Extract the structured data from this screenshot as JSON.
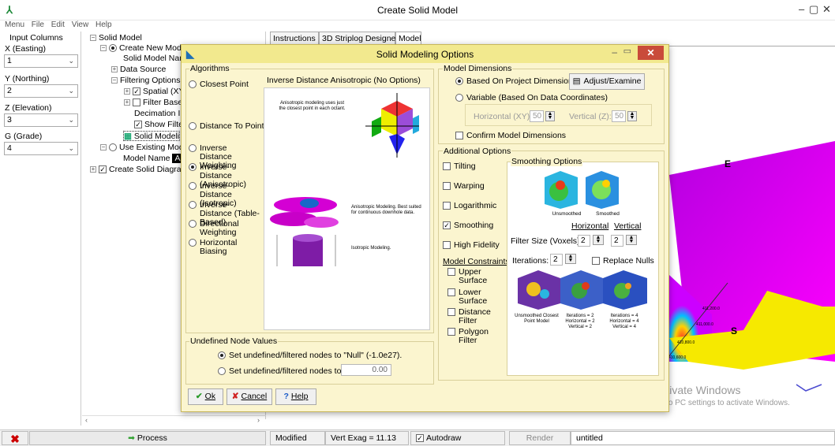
{
  "window": {
    "title": "Create Solid Model",
    "minimize": "–",
    "maximize": "▢",
    "close": "✕"
  },
  "menu": [
    "Menu",
    "File",
    "Edit",
    "View",
    "Help"
  ],
  "input_columns": {
    "header": "Input Columns",
    "fields": [
      {
        "label": "X (Easting)",
        "value": "1"
      },
      {
        "label": "Y (Northing)",
        "value": "2"
      },
      {
        "label": "Z (Elevation)",
        "value": "3"
      },
      {
        "label": "G (Grade)",
        "value": "4"
      }
    ]
  },
  "tree": {
    "root": "Solid Model",
    "create_new": "Create New Mode",
    "model_name_item": "Solid Model Nam",
    "data_source": "Data Source",
    "filtering": "Filtering Options",
    "spatial": "Spatial (XY",
    "filter_base": "Filter Base",
    "decimation": "Decimation In",
    "show_filter": "Show Filte",
    "solid_modeling": "Solid Modeli",
    "use_existing": "Use Existing Mode",
    "model_name_label": "Model Name",
    "model_name_value": "A",
    "create_diagram": "Create Solid Diagram"
  },
  "tabs": [
    "Instructions",
    "3D Striplog Designer",
    "Model"
  ],
  "dialog": {
    "title": "Solid Modeling Options",
    "algorithms": {
      "title": "Algorithms",
      "options": [
        "Closest Point",
        "Distance To Point",
        "Inverse Distance Weighting",
        "Inverse-Distance (Anisotropic)",
        "Inverse-Distance (Isotropic)",
        "Inverse-Distance (Table-Based)",
        "Directional Weighting",
        "Horizontal Biasing"
      ],
      "selected": "Inverse-Distance (Anisotropic)"
    },
    "preview": {
      "title": "Inverse Distance Anisotropic (No Options)",
      "desc1": "Anisotropic modeling uses just the closest point in each octant.",
      "desc2": "Anisotropic Modeling. Best suited for continuous downhole data.",
      "desc3": "Isotropic Modeling."
    },
    "model_dimensions": {
      "title": "Model Dimensions",
      "based_on_project": "Based On Project Dimensions",
      "adjust_button": "Adjust/Examine",
      "variable": "Variable (Based On Data Coordinates)",
      "horizontal_label": "Horizontal (XY):",
      "horizontal_value": "50",
      "vertical_label": "Vertical (Z):",
      "vertical_value": "50",
      "confirm": "Confirm Model Dimensions"
    },
    "additional": {
      "title": "Additional Options",
      "checks": [
        {
          "label": "Tilting",
          "checked": false
        },
        {
          "label": "Warping",
          "checked": false
        },
        {
          "label": "Logarithmic",
          "checked": false
        },
        {
          "label": "Smoothing",
          "checked": true
        },
        {
          "label": "High Fidelity",
          "checked": false
        }
      ],
      "constraints_title": "Model Constraints",
      "constraints": [
        "Upper Surface",
        "Lower Surface",
        "Distance Filter",
        "Polygon Filter"
      ]
    },
    "smoothing": {
      "title": "Smoothing Options",
      "img_label_a": "Unsmoothed",
      "img_label_b": "Smoothed",
      "horizontal_header": "Horizontal",
      "vertical_header": "Vertical",
      "filter_size_label": "Filter Size (Voxels):",
      "filter_h": "2",
      "filter_v": "2",
      "iterations_label": "Iterations:",
      "iterations": "2",
      "replace_nulls": "Replace Nulls",
      "cap1": "Unsmoothed Closest Point Model",
      "cap2": "Iterations = 2 Horizontal = 2 Vertical = 2",
      "cap3": "Iterations = 4 Horizontal = 4 Vertical = 4"
    },
    "undefined": {
      "title": "Undefined Node Values",
      "opt1": "Set undefined/filtered nodes to \"Null\" (-1.0e27).",
      "opt2": "Set undefined/filtered nodes to:",
      "value": "0.00"
    },
    "buttons": {
      "ok": "Ok",
      "cancel": "Cancel",
      "help": "Help"
    }
  },
  "canvas": {
    "label_e": "E",
    "label_s": "S",
    "tick1": "411,200.0",
    "tick2": "411,000.0",
    "tick3": "410,800.0",
    "tick4": "410,600.0"
  },
  "watermark": {
    "line1": "Activate Windows",
    "line2": "Go to PC settings to activate Windows."
  },
  "status": {
    "process": "Process",
    "modified": "Modified",
    "vert_exag": "Vert Exag = 11.13",
    "autodraw": "Autodraw",
    "render": "Render",
    "file": "untitled"
  }
}
